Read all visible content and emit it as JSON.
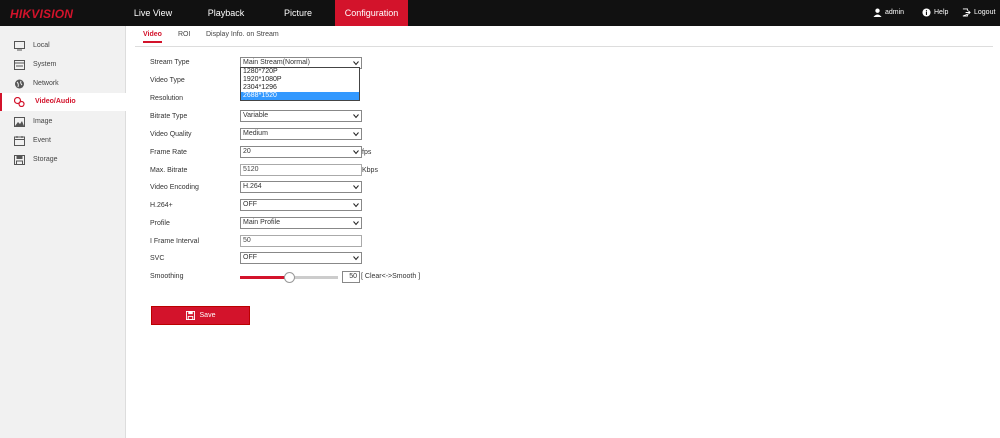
{
  "brand": "HIKVISION",
  "nav": [
    {
      "label": "Live View"
    },
    {
      "label": "Playback"
    },
    {
      "label": "Picture"
    },
    {
      "label": "Configuration"
    }
  ],
  "top_right": {
    "user": "admin",
    "help": "Help",
    "logout": "Logout"
  },
  "sidebar": [
    {
      "label": "Local",
      "icon": "monitor-icon"
    },
    {
      "label": "System",
      "icon": "system-icon"
    },
    {
      "label": "Network",
      "icon": "globe-icon"
    },
    {
      "label": "Video/Audio",
      "icon": "video-audio-icon"
    },
    {
      "label": "Image",
      "icon": "image-icon"
    },
    {
      "label": "Event",
      "icon": "calendar-icon"
    },
    {
      "label": "Storage",
      "icon": "disk-icon"
    }
  ],
  "tabs": [
    {
      "label": "Video"
    },
    {
      "label": "ROI"
    },
    {
      "label": "Display Info. on Stream"
    }
  ],
  "form": {
    "stream_type": {
      "label": "Stream Type",
      "value": "Main Stream(Normal)"
    },
    "video_type": {
      "label": "Video Type"
    },
    "resolution": {
      "label": "Resolution",
      "options": [
        "1280*720P",
        "1920*1080P",
        "2304*1296",
        "2688*1520"
      ],
      "selected_index": 3
    },
    "bitrate_type": {
      "label": "Bitrate Type",
      "value": "Variable"
    },
    "video_quality": {
      "label": "Video Quality",
      "value": "Medium"
    },
    "frame_rate": {
      "label": "Frame Rate",
      "value": "20",
      "unit": "fps"
    },
    "max_bitrate": {
      "label": "Max. Bitrate",
      "value": "5120",
      "unit": "Kbps"
    },
    "video_encoding": {
      "label": "Video Encoding",
      "value": "H.264"
    },
    "h264_plus": {
      "label": "H.264+",
      "value": "OFF"
    },
    "profile": {
      "label": "Profile",
      "value": "Main Profile"
    },
    "i_frame_interval": {
      "label": "I Frame Interval",
      "value": "50"
    },
    "svc": {
      "label": "SVC",
      "value": "OFF"
    },
    "smoothing": {
      "label": "Smoothing",
      "value": "50",
      "level": 0.5,
      "hint": "[ Clear<->Smooth ]"
    }
  },
  "save_label": "Save",
  "colors": {
    "accent": "#d3132b",
    "topbar": "#111111",
    "selected_option": "#3399ff"
  }
}
